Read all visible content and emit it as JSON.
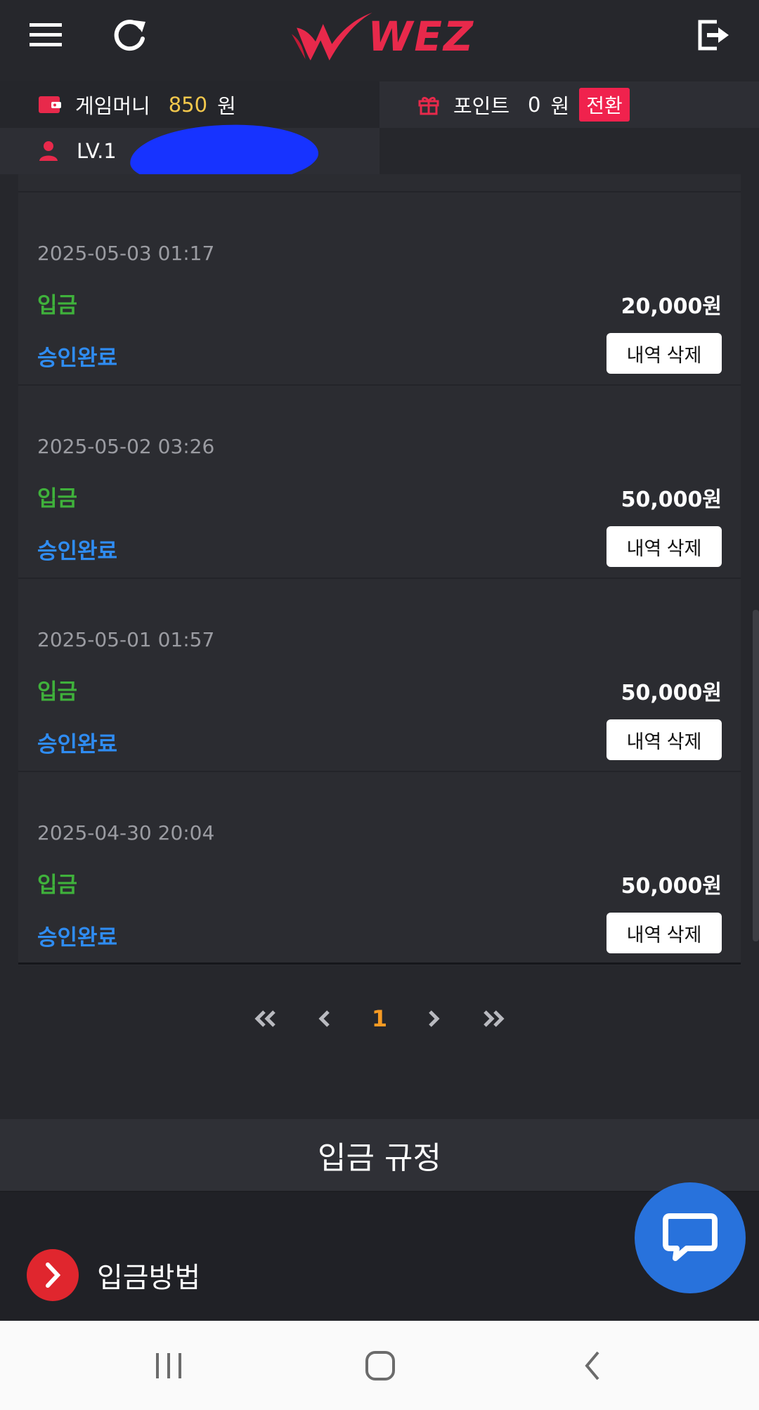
{
  "header": {
    "logo_text": "WEZ",
    "menu_icon": "hamburger-menu-icon",
    "refresh_icon": "refresh-icon",
    "logout_icon": "logout-icon"
  },
  "wallet": {
    "money_label": "게임머니",
    "money_value": "850",
    "money_unit": "원",
    "point_label": "포인트",
    "point_value": "0",
    "point_unit": "원",
    "convert_label": "전환",
    "level_label": "LV.1"
  },
  "transactions": [
    {
      "datetime": "2025-05-03 01:17",
      "type": "입금",
      "amount": "20,000원",
      "status": "승인완료",
      "delete_label": "내역 삭제"
    },
    {
      "datetime": "2025-05-02 03:26",
      "type": "입금",
      "amount": "50,000원",
      "status": "승인완료",
      "delete_label": "내역 삭제"
    },
    {
      "datetime": "2025-05-01 01:57",
      "type": "입금",
      "amount": "50,000원",
      "status": "승인완료",
      "delete_label": "내역 삭제"
    },
    {
      "datetime": "2025-04-30 20:04",
      "type": "입금",
      "amount": "50,000원",
      "status": "승인완료",
      "delete_label": "내역 삭제"
    }
  ],
  "pagination": {
    "current_page": "1"
  },
  "rules": {
    "title": "입금 규정",
    "method_label": "입금방법"
  },
  "colors": {
    "brand_red": "#e8294b",
    "deposit_green": "#3fb13b",
    "approved_blue": "#2f8cf2",
    "page_orange": "#f59a23",
    "chat_blue": "#2872dc"
  }
}
